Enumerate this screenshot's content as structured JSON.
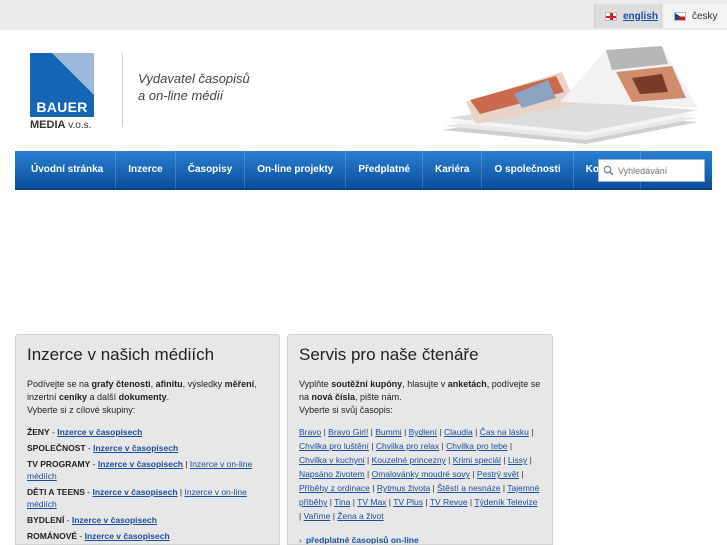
{
  "languages": [
    {
      "label": "english",
      "active": true
    },
    {
      "label": "česky",
      "active": false
    }
  ],
  "logo": {
    "name": "BAUER",
    "sub_bold": "MEDIA",
    "sub_rest": " v.o.s."
  },
  "tagline": {
    "line1": "Vydavatel časopisů",
    "line2": "a on-line médií"
  },
  "nav": {
    "items": [
      "Úvodní stránka",
      "Inzerce",
      "Časopisy",
      "On-line projekty",
      "Předplatné",
      "Kariéra",
      "O společnosti",
      "Kontakty"
    ],
    "search_placeholder": "Vyhledávání"
  },
  "left_box": {
    "title": "Inzerce v našich médiích",
    "intro": [
      "Podívejte se na ",
      "grafy čtenosti",
      ", ",
      "afinitu",
      ", výsledky ",
      "měření",
      ", inzertní ",
      "ceníky",
      " a další ",
      "dokumenty",
      "."
    ],
    "intro2": "Vyberte si z cílové skupiny:",
    "groups": [
      {
        "name": "ŽENY",
        "links": [
          "Inzerce v časopisech"
        ]
      },
      {
        "name": "SPOLEČNOST",
        "links": [
          "Inzerce v časopisech"
        ]
      },
      {
        "name": "TV PROGRAMY",
        "links": [
          "Inzerce v časopisech",
          "Inzerce v on-line médiích"
        ]
      },
      {
        "name": "DĚTI A TEENS",
        "links": [
          "Inzerce v časopisech",
          "Inzerce v on-line médiích"
        ]
      },
      {
        "name": "BYDLENÍ",
        "links": [
          "Inzerce v časopisech"
        ]
      },
      {
        "name": "ROMÁNOVÉ",
        "links": [
          "Inzerce v časopisech"
        ]
      }
    ]
  },
  "right_box": {
    "title": "Servis pro naše čtenáře",
    "intro": [
      "Vyplňte ",
      "soutěžní kupóny",
      ", hlasujte v ",
      "anketách",
      ", podívejte se na ",
      "nová čísla",
      ", pište nám."
    ],
    "intro2": "Vyberte si svůj časopis:",
    "magazines": [
      "Bravo",
      "Bravo Girl!",
      "Bummi",
      "Bydlení",
      "Claudia",
      "Čas na lásku",
      "Chvilka pro luštění",
      "Chvilka pro relax",
      "Chvilka pro tebe",
      "Chvilka v kuchyni",
      "Kouzelné princezny",
      "Krimi speciál",
      "Lissy",
      "Napsáno životem",
      "Omalovánky moudré sovy",
      "Pestrý svět",
      "Příběhy z ordinace",
      "Rytmus života",
      "Štěstí a nesnáze",
      "Tajemné příběhy",
      "Tina",
      "TV Max",
      "TV Plus",
      "TV Revue",
      "Týdeník Televize",
      "Vaříme",
      "Žena a život"
    ],
    "more_link": "předplatné časopisů on-line"
  },
  "colors": {
    "nav_top": "#2a7fd0",
    "nav_bottom": "#0d4f9e",
    "logo_blue": "#1565b6",
    "link": "#1a4fa0"
  },
  "icons": {
    "search": "search-icon",
    "flag_en": "flag-uk-icon",
    "flag_cz": "flag-cz-icon"
  }
}
